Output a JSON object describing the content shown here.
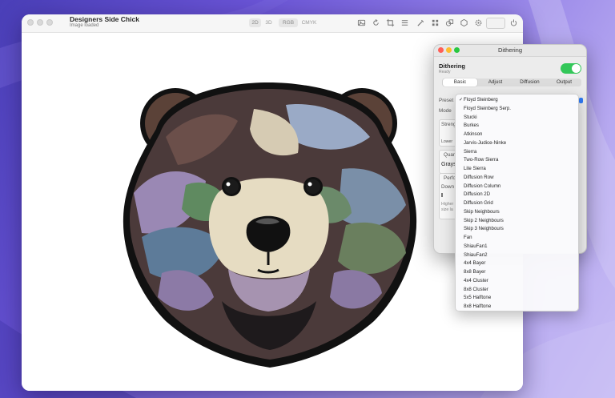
{
  "window": {
    "title": "Designers Side Chick",
    "status": "Image loaded",
    "view_modes": [
      "2D",
      "3D"
    ],
    "color_modes": [
      "RGB",
      "CMYK"
    ],
    "toolbar_icons": [
      "photo-icon",
      "rotate-icon",
      "crop-icon",
      "list-icon",
      "eyedropper-icon",
      "grid-icon",
      "shape-icon",
      "hexagon-icon",
      "settings-gear-icon",
      "power-icon"
    ]
  },
  "panel": {
    "title": "Dithering",
    "heading": "Dithering",
    "status": "Ready",
    "enabled": true,
    "tabs": [
      "Basic",
      "Adjust",
      "Diffusion",
      "Output"
    ],
    "selected_tab": "Basic",
    "rows": {
      "preset": "Preset",
      "mode": "Mode",
      "strength": "Streng",
      "lower": "Lower",
      "quantize": "Quan",
      "grayscale": "Grays",
      "performance": "Perfo",
      "downscale": "Down",
      "higher_note": "Higher",
      "size_note": "size la"
    }
  },
  "dropdown": {
    "selected": "Floyd Steinberg",
    "check": "✓",
    "items": [
      "Floyd Steinberg",
      "Floyd Steinberg Serp.",
      "Stucki",
      "Burkes",
      "Atkinson",
      "Jarvis-Judice-Ninke",
      "Sierra",
      "Two-Row Sierra",
      "Lite Sierra",
      "Diffusion Row",
      "Diffusion Column",
      "Diffusion 2D",
      "Diffusion Grid",
      "Skip Neighbours",
      "Skip 2 Neighbours",
      "Skip 3 Neighbours",
      "Fan",
      "ShiauFan1",
      "ShiauFan2",
      "4x4 Bayer",
      "8x8 Bayer",
      "4x4 Cluster",
      "8x8 Cluster",
      "5x5 Halftone",
      "8x8 Halftone"
    ]
  },
  "colors": {
    "accent": "#2f7bf5",
    "toggle_on": "#33c759"
  }
}
